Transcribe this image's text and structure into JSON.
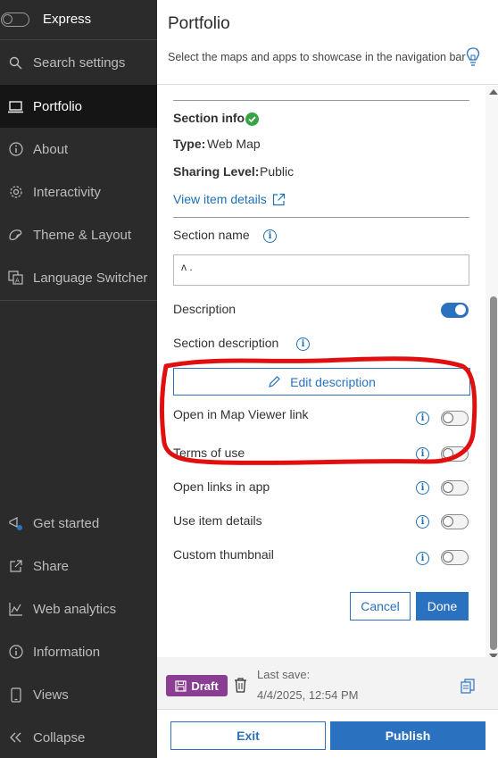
{
  "sidebar": {
    "express_label": "Express",
    "search_label": "Search settings",
    "items": [
      {
        "label": "Portfolio",
        "icon": "laptop-icon",
        "active": true
      },
      {
        "label": "About",
        "icon": "info-icon"
      },
      {
        "label": "Interactivity",
        "icon": "gear-icon"
      },
      {
        "label": "Theme & Layout",
        "icon": "palette-icon"
      },
      {
        "label": "Language Switcher",
        "icon": "language-icon"
      }
    ],
    "bottom_items": [
      {
        "label": "Get started",
        "icon": "megaphone-icon"
      },
      {
        "label": "Share",
        "icon": "share-icon"
      },
      {
        "label": "Web analytics",
        "icon": "analytics-icon"
      },
      {
        "label": "Information",
        "icon": "info-icon"
      },
      {
        "label": "Views",
        "icon": "phone-icon"
      },
      {
        "label": "Collapse",
        "icon": "chevrons-left-icon"
      }
    ]
  },
  "header": {
    "title": "Portfolio",
    "subtitle": "Select the maps and apps to showcase in the navigation bar"
  },
  "section": {
    "info_label": "Section info",
    "type_label": "Type:",
    "type_value": "Web Map",
    "sharing_label": "Sharing Level:",
    "sharing_value": "Public",
    "view_details_link": "View item details",
    "name_label": "Section name",
    "name_value": "ᴧ                  .",
    "description_label": "Description",
    "section_description_label": "Section description",
    "edit_description_button": "Edit description",
    "toggles": {
      "open_map_viewer": "Open in Map Viewer link",
      "terms_of_use": "Terms of use",
      "open_links_in_app": "Open links in app",
      "use_item_details": "Use item details",
      "custom_thumbnail": "Custom thumbnail"
    },
    "cancel_button": "Cancel",
    "done_button": "Done"
  },
  "savebar": {
    "draft_badge": "Draft",
    "last_save_label": "Last save:",
    "last_save_value": "4/4/2025, 12:54 PM"
  },
  "footer": {
    "exit_button": "Exit",
    "publish_button": "Publish"
  },
  "colors": {
    "accent": "#2a72c0",
    "draft": "#8a3e91",
    "success": "#35a543",
    "annotation": "#e11010"
  }
}
